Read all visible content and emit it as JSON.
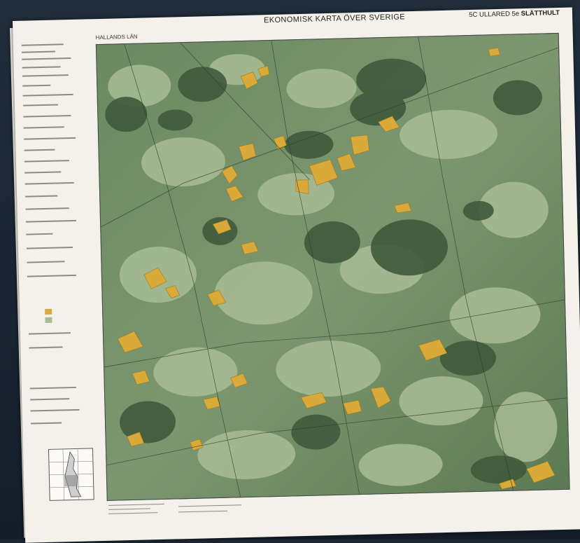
{
  "map": {
    "title": "EKONOMISK KARTA ÖVER SVERIGE",
    "sheet_code": "5C ULLARED 5e",
    "sheet_name": "SLÄTTHULT",
    "county": "HALLANDS LÄN"
  },
  "colors": {
    "forest_dark": "#3f5a3c",
    "forest_mid": "#5f7a55",
    "open_light": "#a9bc95",
    "field_yellow": "#d9a93a",
    "paper": "#f3f1ea",
    "background": "#1c2633"
  }
}
